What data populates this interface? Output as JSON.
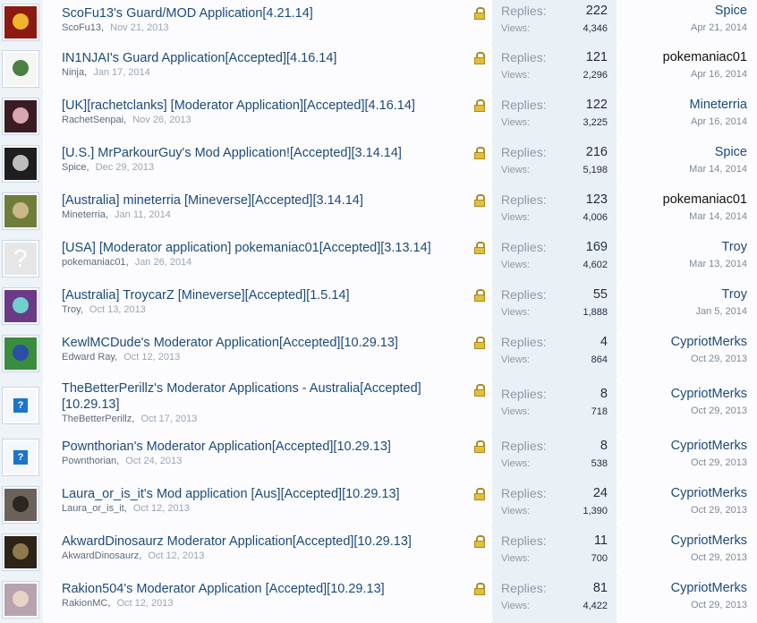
{
  "stat_labels": {
    "replies": "Replies:",
    "views": "Views:"
  },
  "threads": [
    {
      "title": "ScoFu13's Guard/MOD Application[4.21.14]",
      "author": "ScoFu13",
      "date": "Nov 21, 2013",
      "replies": "222",
      "views": "4,346",
      "last_user": "Spice",
      "last_date": "Apr 21, 2014",
      "avatar_bg": "#8b1a12",
      "avatar_fg": "#f0b52c"
    },
    {
      "title": "IN1NJAI's Guard Application[Accepted][4.16.14]",
      "author": "Ninja",
      "date": "Jan 17, 2014",
      "replies": "121",
      "views": "2,296",
      "last_user": "pokemaniac01",
      "last_date": "Apr 16, 2014",
      "avatar_bg": "#f3f6f3",
      "avatar_fg": "#4b7f45"
    },
    {
      "title": "[UK][rachetclanks] [Moderator Application][Accepted][4.16.14]",
      "author": "RachetSenpai",
      "date": "Nov 26, 2013",
      "replies": "122",
      "views": "3,225",
      "last_user": "Mineterria",
      "last_date": "Apr 16, 2014",
      "avatar_bg": "#3a1c24",
      "avatar_fg": "#d9a7b2"
    },
    {
      "title": "[U.S.] MrParkourGuy's Mod Application![Accepted][3.14.14]",
      "author": "Spice",
      "date": "Dec 29, 2013",
      "replies": "216",
      "views": "5,198",
      "last_user": "Spice",
      "last_date": "Mar 14, 2014",
      "avatar_bg": "#1e1e1e",
      "avatar_fg": "#bdbdbd"
    },
    {
      "title": "[Australia] mineterria [Mineverse][Accepted][3.14.14]",
      "author": "Mineterria",
      "date": "Jan 11, 2014",
      "replies": "123",
      "views": "4,006",
      "last_user": "pokemaniac01",
      "last_date": "Mar 14, 2014",
      "avatar_bg": "#6f7d3a",
      "avatar_fg": "#c9b98a"
    },
    {
      "title": "[USA] [Moderator application] pokemaniac01[Accepted][3.13.14]",
      "author": "pokemaniac01",
      "date": "Jan 26, 2014",
      "replies": "169",
      "views": "4,602",
      "last_user": "Troy",
      "last_date": "Mar 13, 2014",
      "avatar_bg": "#e6e6e6",
      "avatar_fg": "#ffffff"
    },
    {
      "title": "[Australia] TroycarZ [Mineverse][Accepted][1.5.14]",
      "author": "Troy",
      "date": "Oct 13, 2013",
      "replies": "55",
      "views": "1,888",
      "last_user": "Troy",
      "last_date": "Jan 5, 2014",
      "avatar_bg": "#6a3a86",
      "avatar_fg": "#6fd0cf"
    },
    {
      "title": "KewlMCDude's Moderator Application[Accepted][10.29.13]",
      "author": "Edward Ray",
      "date": "Oct 12, 2013",
      "replies": "4",
      "views": "864",
      "last_user": "CypriotMerks",
      "last_date": "Oct 29, 2013",
      "avatar_bg": "#3a8c3f",
      "avatar_fg": "#2b4fa8"
    },
    {
      "title": "TheBetterPerillz's Moderator Applications - Australia[Accepted][10.29.13]",
      "author": "TheBetterPerillz",
      "date": "Oct 17, 2013",
      "replies": "8",
      "views": "718",
      "last_user": "CypriotMerks",
      "last_date": "Oct 29, 2013",
      "avatar_bg": "#f4f7fb",
      "avatar_fg": "#1d74c9"
    },
    {
      "title": "Pownthorian's Moderator Application[Accepted][10.29.13]",
      "author": "Pownthorian",
      "date": "Oct 24, 2013",
      "replies": "8",
      "views": "538",
      "last_user": "CypriotMerks",
      "last_date": "Oct 29, 2013",
      "avatar_bg": "#f4f7fb",
      "avatar_fg": "#1d74c9"
    },
    {
      "title": "Laura_or_is_it's Mod application [Aus][Accepted][10.29.13]",
      "author": "Laura_or_is_it",
      "date": "Oct 12, 2013",
      "replies": "24",
      "views": "1,390",
      "last_user": "CypriotMerks",
      "last_date": "Oct 29, 2013",
      "avatar_bg": "#6b625a",
      "avatar_fg": "#2a2622"
    },
    {
      "title": "AkwardDinosaurz Moderator Application[Accepted][10.29.13]",
      "author": "AkwardDinosaurz",
      "date": "Oct 12, 2013",
      "replies": "11",
      "views": "700",
      "last_user": "CypriotMerks",
      "last_date": "Oct 29, 2013",
      "avatar_bg": "#2b2417",
      "avatar_fg": "#8c7a4e"
    },
    {
      "title": "Rakion504's Moderator Application [Accepted][10.29.13]",
      "author": "RakionMC",
      "date": "Oct 12, 2013",
      "replies": "81",
      "views": "4,422",
      "last_user": "CypriotMerks",
      "last_date": "Oct 29, 2013",
      "avatar_bg": "#b7a3ad",
      "avatar_fg": "#e8d3c8"
    }
  ]
}
